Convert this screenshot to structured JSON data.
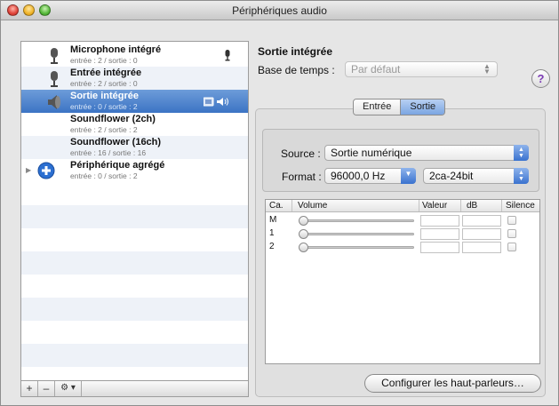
{
  "window": {
    "title": "Périphériques audio"
  },
  "devices": [
    {
      "name": "Microphone intégré",
      "sub": "entrée : 2 / sortie : 0",
      "icon": "microphone-icon",
      "badge": "mic-input-icon"
    },
    {
      "name": "Entrée intégrée",
      "sub": "entrée : 2 / sortie : 0",
      "icon": "microphone-icon"
    },
    {
      "name": "Sortie intégrée",
      "sub": "entrée : 0 / sortie : 2",
      "icon": "speaker-icon",
      "badge": "speaker-output-icon",
      "selected": true
    },
    {
      "name": "Soundflower (2ch)",
      "sub": "entrée : 2 / sortie : 2"
    },
    {
      "name": "Soundflower (16ch)",
      "sub": "entrée : 16 / sortie : 16"
    },
    {
      "name": "Périphérique agrégé",
      "sub": "entrée : 0 / sortie : 2",
      "icon": "plus-icon"
    }
  ],
  "sidebar_buttons": {
    "add": "+",
    "remove": "–",
    "action": "⚙ ▾"
  },
  "detail": {
    "title": "Sortie intégrée",
    "clock_label": "Base de temps :",
    "clock_value": "Par défaut",
    "help": "?"
  },
  "tabs": [
    {
      "label": "Entrée"
    },
    {
      "label": "Sortie",
      "active": true
    }
  ],
  "source": {
    "label": "Source :",
    "value": "Sortie numérique"
  },
  "format": {
    "label": "Format :",
    "rate": "96000,0 Hz",
    "bits": "2ca-24bit"
  },
  "mixer": {
    "headers": {
      "channel": "Ca.",
      "volume": "Volume",
      "value": "Valeur",
      "db": "dB",
      "mute": "Silence"
    },
    "channels": [
      {
        "ch": "M"
      },
      {
        "ch": "1"
      },
      {
        "ch": "2"
      }
    ]
  },
  "configure_button": "Configurer les haut-parleurs…",
  "colors": {
    "selection": "#3c74c4",
    "help": "#7b3bb3"
  }
}
